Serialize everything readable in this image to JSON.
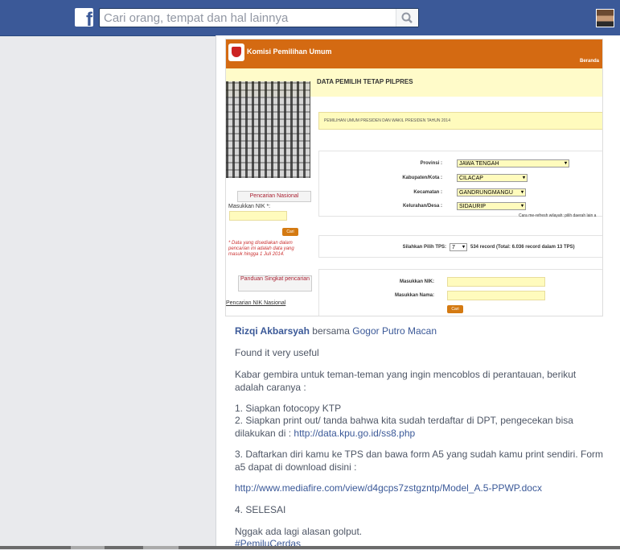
{
  "topbar": {
    "search_placeholder": "Cari orang, tempat dan hal lainnya",
    "logo": "f"
  },
  "kpu": {
    "site_title": "Komisi Pemilihan Umum",
    "beranda": "Beranda",
    "heading": "DATA PEMILIH TETAP PILPRES",
    "election": "PEMILIHAN UMUM PRESIDEN DAN WAKIL PRESIDEN TAHUN 2014",
    "search_national": "Pencarian Nasional",
    "masukkan_nik_star": "Masukkan NIK *:",
    "cari": "Cari",
    "note": "* Data yang disediakan dalam pencarian ini adalah data yang masuk hingga 1 Juli 2014.",
    "guide": "Panduan Singkat pencarian",
    "guide_link": "Pencarian NIK Nasional",
    "labels": {
      "provinsi": "Provinsi :",
      "kabupaten": "Kabupaten/Kota :",
      "kecamatan": "Kecamatan :",
      "kelurahan": "Kelurahan/Desa :"
    },
    "values": {
      "provinsi": "JAWA TENGAH",
      "kabupaten": "CILACAP",
      "kecamatan": "GANDRUNGMANGU",
      "kelurahan": "SIDAURIP"
    },
    "refresh_note": "Cara me-refresh wilayah: pilih daerah lain a",
    "tps_label": "Silahkan Pilih TPS:",
    "tps_value": "7",
    "tps_record": "534 record (Total: 6.036 record dalam 13 TPS)",
    "nik_label": "Masukkan NIK:",
    "nama_label": "Masukkan Nama:"
  },
  "post": {
    "author": "Rizqi Akbarsyah",
    "with": "bersama",
    "tagged": "Gogor Putro Macan",
    "line1": "Found it very useful",
    "line2": "Kabar gembira untuk teman-teman yang ingin mencoblos di perantauan, berikut adalah caranya :",
    "step1": "1. Siapkan fotocopy KTP",
    "step2": "2. Siapkan print out/ tanda bahwa kita sudah terdaftar di DPT, pengecekan bisa dilakukan di :",
    "step2_link": "http://data.kpu.go.id/ss8.php",
    "step3": "3. Daftarkan diri kamu ke TPS dan bawa form A5 yang sudah kamu print sendiri. Form a5 dapat di download disini :",
    "download_link": "http://www.mediafire.com/view/d4gcps7zstgzntp/Model_A.5-PPWP.docx",
    "step4": "4. SELESAI",
    "closing": "Nggak ada lagi alasan golput.",
    "hashtag": "#PemiluCerdas"
  }
}
